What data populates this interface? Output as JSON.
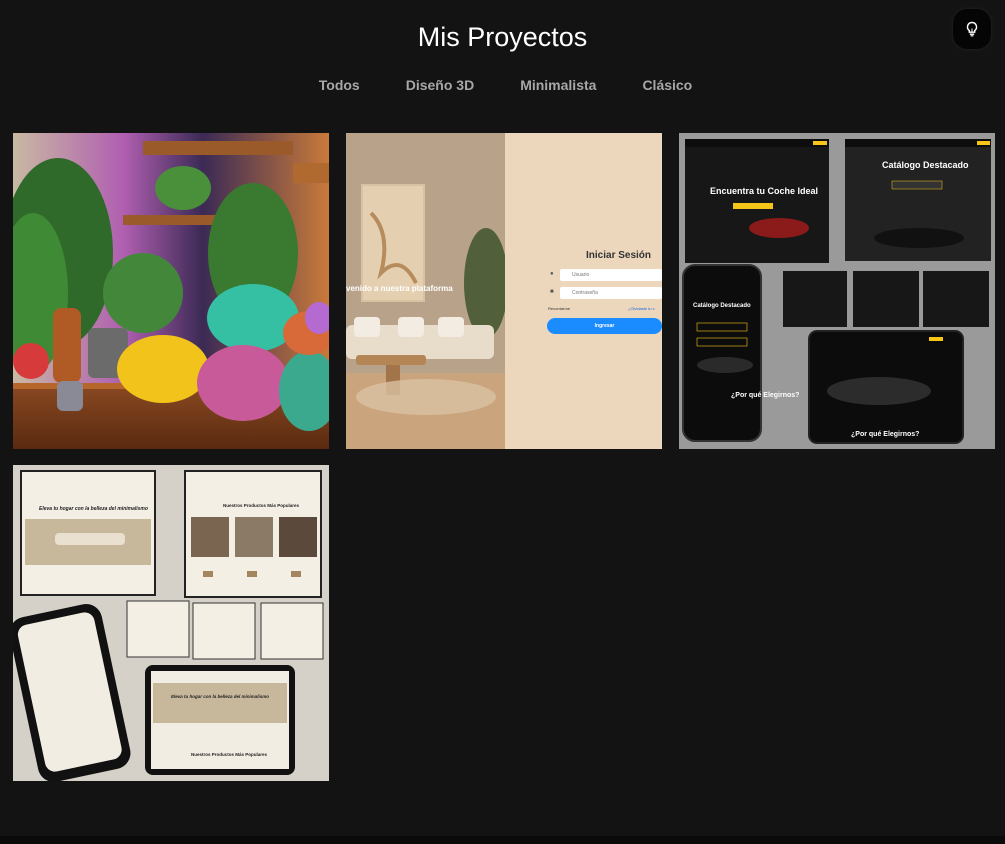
{
  "header": {
    "title": "Mis Proyectos"
  },
  "theme_toggle": {
    "icon": "lightbulb-icon"
  },
  "filters": [
    {
      "label": "Todos"
    },
    {
      "label": "Diseño 3D"
    },
    {
      "label": "Minimalista"
    },
    {
      "label": "Clásico"
    }
  ],
  "projects": [
    {
      "name": "3d-plants-room"
    },
    {
      "name": "login-page",
      "login_title": "Iniciar Sesión",
      "welcome": "venido a nuestra plataforma",
      "user_placeholder": "Usuario",
      "pass_placeholder": "Contraseña",
      "remember": "Recordarme",
      "forgot": "¿Olvidaste tu c",
      "button": "Ingresar"
    },
    {
      "name": "car-catalog",
      "hero": "Encuentra tu Coche Ideal",
      "catalog": "Catálogo Destacado",
      "phone_catalog": "Catálogo Destacado",
      "why": "¿Por qué Elegirnos?",
      "why2": "¿Por qué Elegirnos?"
    },
    {
      "name": "minimal-furniture",
      "hero": "Eleva tu hogar con la belleza del minimalismo",
      "products": "Nuestros Productos Más Populares",
      "phone_hero": "Eleva tu hogar con la belleza del minimalismo",
      "phone_products": "Nuestros Productos Más Populares"
    }
  ],
  "colors": {
    "background": "#131313",
    "title": "#ffffff",
    "filter": "#a7a7a7",
    "login_button": "#1a8cff"
  }
}
